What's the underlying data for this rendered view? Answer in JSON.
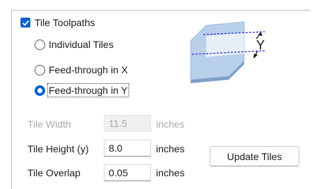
{
  "tile_toolpaths": {
    "label": "Tile Toolpaths",
    "checked": true
  },
  "options": [
    {
      "label": "Individual Tiles",
      "selected": false
    },
    {
      "label": "Feed-through in X",
      "selected": false
    },
    {
      "label": "Feed-through in Y",
      "selected": true
    }
  ],
  "tile_width": {
    "label": "Tile Width",
    "value": "11.5",
    "units": "inches"
  },
  "tile_height": {
    "label": "Tile Height (y)",
    "value": "8.0",
    "units": "inches"
  },
  "tile_overlap": {
    "label": "Tile Overlap",
    "value": "0.05",
    "units": "inches"
  },
  "update_button": "Update Tiles",
  "diagram_axis": "Y",
  "accent_color": "#0a63c9"
}
